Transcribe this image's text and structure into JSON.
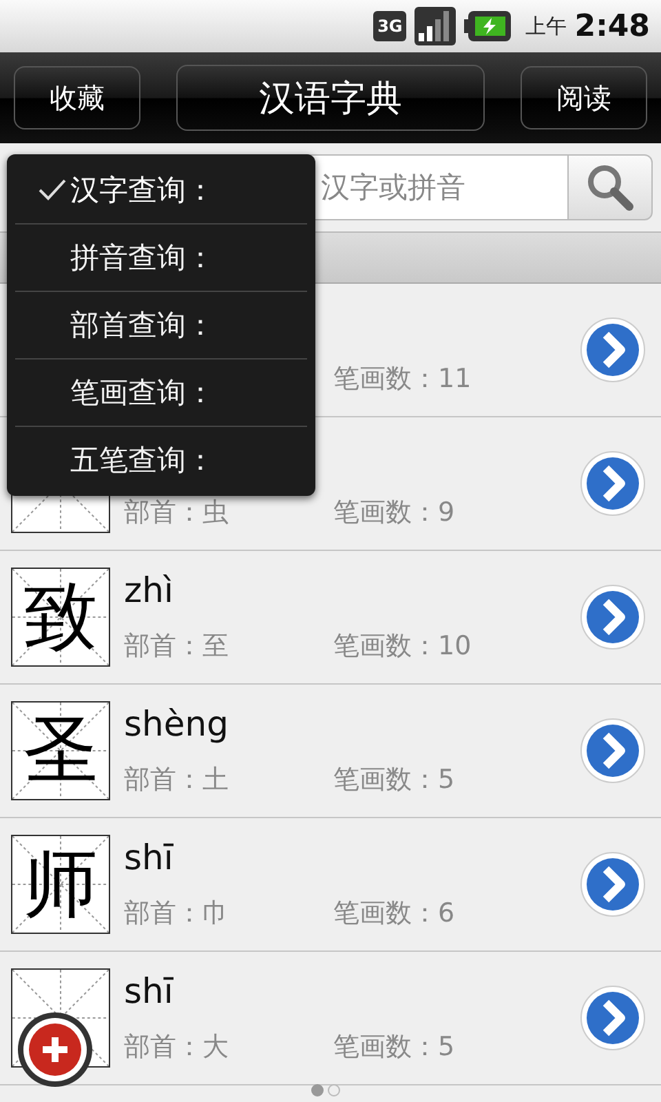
{
  "status_bar": {
    "network": "3G",
    "ampm": "上午",
    "time": "2:48"
  },
  "toolbar": {
    "left_button": "收藏",
    "title": "汉语字典",
    "right_button": "阅读"
  },
  "search": {
    "placeholder": "汉字或拼音"
  },
  "rows": [
    {
      "strokes": "笔画数：11"
    },
    {
      "radical": "部首：虫",
      "strokes": "笔画数：9"
    },
    {
      "char": "致",
      "pinyin": "zhì",
      "radical": "部首：至",
      "strokes": "笔画数：10"
    },
    {
      "char": "圣",
      "pinyin": "shèng",
      "radical": "部首：土",
      "strokes": "笔画数：5"
    },
    {
      "char": "师",
      "pinyin": "shī",
      "radical": "部首：巾",
      "strokes": "笔画数：6"
    },
    {
      "pinyin": "shī",
      "radical": "部首：大",
      "strokes": "笔画数：5"
    }
  ],
  "search_menu": [
    {
      "label": "汉字查询：",
      "selected": true
    },
    {
      "label": "拼音查询：",
      "selected": false
    },
    {
      "label": "部首查询：",
      "selected": false
    },
    {
      "label": "笔画查询：",
      "selected": false
    },
    {
      "label": "五笔查询：",
      "selected": false
    }
  ],
  "pager": [
    {
      "selected": true
    },
    {
      "selected": false
    }
  ]
}
